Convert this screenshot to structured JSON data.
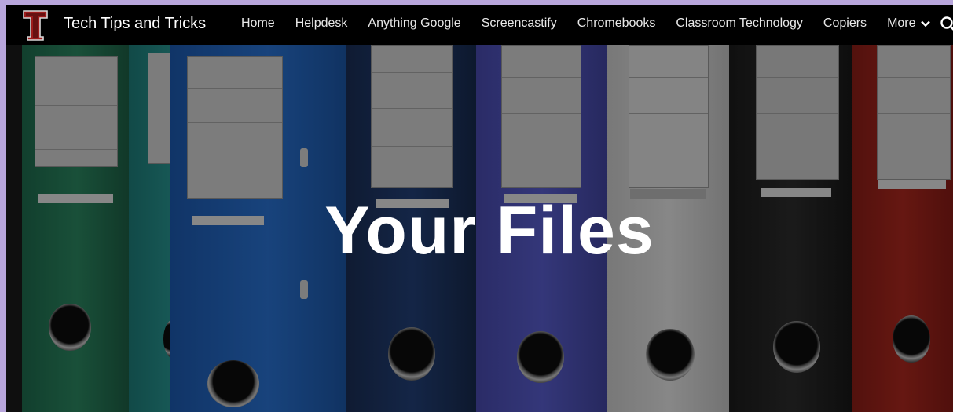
{
  "site": {
    "title": "Tech Tips and Tricks",
    "logo_icon": "t-letter-logo-icon",
    "brand_color": "#9e1b1b"
  },
  "nav": {
    "items": [
      {
        "label": "Home"
      },
      {
        "label": "Helpdesk"
      },
      {
        "label": "Anything Google"
      },
      {
        "label": "Screencastify"
      },
      {
        "label": "Chromebooks"
      },
      {
        "label": "Classroom Technology"
      },
      {
        "label": "Copiers"
      }
    ],
    "more_label": "More",
    "search_icon": "search-icon"
  },
  "hero": {
    "title": "Your Files",
    "background": "binders-photo"
  }
}
